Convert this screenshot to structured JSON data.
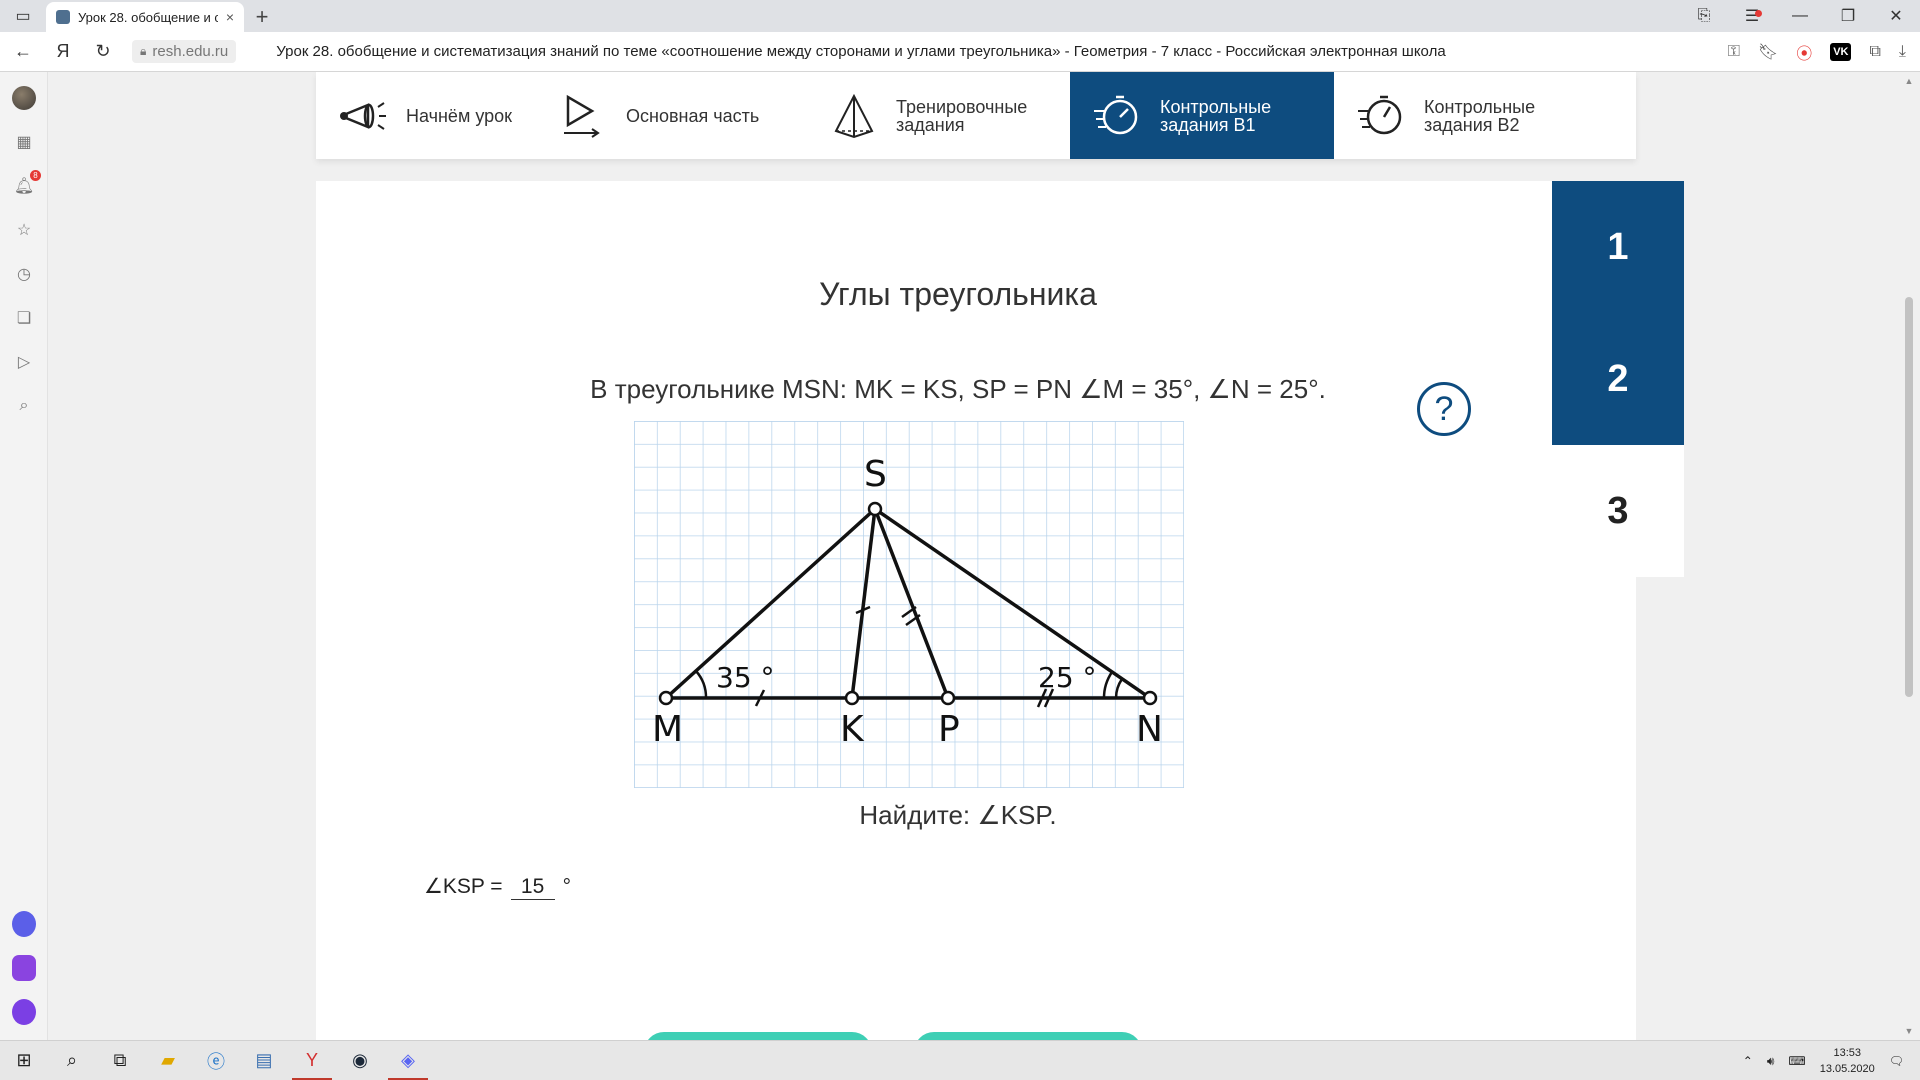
{
  "browser": {
    "tab_title": "Урок 28. обобщение и с",
    "tab_close": "×",
    "new_tab": "+",
    "domain": "resh.edu.ru",
    "page_title": "Урок 28. обобщение и систематизация знаний по теме «соотношение между сторонами и углами треугольника» - Геометрия - 7 класс - Российская электронная школа",
    "yandex_letter": "Я",
    "vk_label": "VK"
  },
  "sidebar": {
    "notification_count": "8"
  },
  "lesson_nav": {
    "items": [
      {
        "label": "Начнём урок"
      },
      {
        "label": "Основная часть"
      },
      {
        "label": "Тренировочные\nзадания"
      },
      {
        "label": "Контрольные\nзадания В1"
      },
      {
        "label": "Контрольные\nзадания В2"
      }
    ],
    "active_index": 3
  },
  "task_numbers": [
    "1",
    "2",
    "3"
  ],
  "task": {
    "title": "Углы треугольника",
    "condition": "В треугольнике MSN: MK = KS, SP = PN ∠M = 35°, ∠N = 25°.",
    "help": "?",
    "find": "Найдите: ∠KSP.",
    "answer_label": "∠KSP =",
    "answer_value": "15",
    "answer_unit": "°"
  },
  "figure": {
    "points": [
      "S",
      "M",
      "K",
      "P",
      "N"
    ],
    "angle_m": "35 °",
    "angle_n": "25 °"
  },
  "taskbar": {
    "time": "13:53",
    "date": "13.05.2020"
  },
  "colors": {
    "accent": "#0e4c7f",
    "grid": "#b9d4ec",
    "button": "#3ecfb5"
  }
}
